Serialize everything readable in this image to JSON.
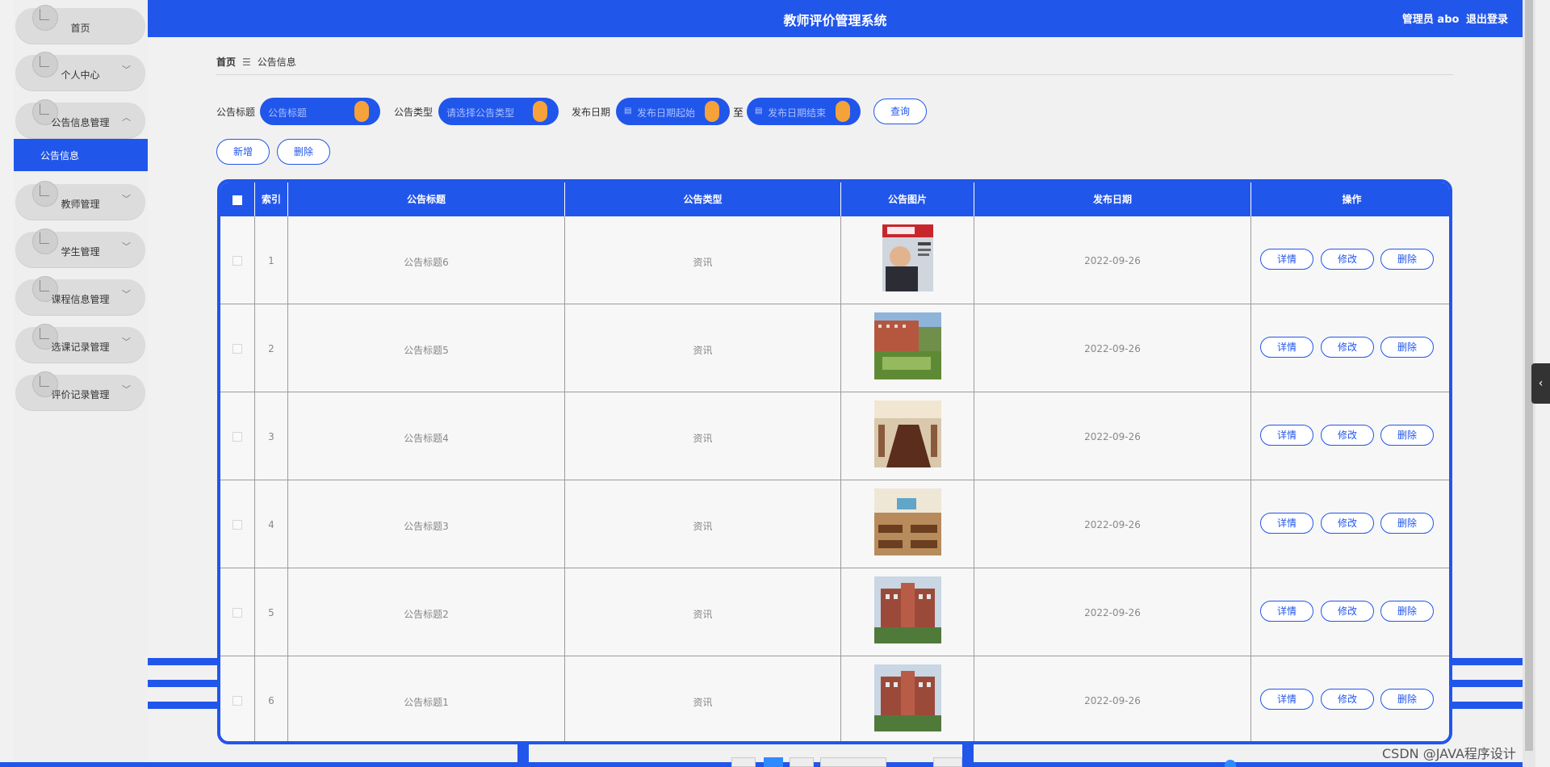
{
  "app": {
    "title": "教师评价管理系统"
  },
  "header": {
    "user_label": "管理员 abo",
    "logout_label": "退出登录"
  },
  "sidebar": {
    "items": [
      {
        "label": "首页",
        "chevron": ""
      },
      {
        "label": "个人中心",
        "chevron": "﹀"
      },
      {
        "label": "公告信息管理",
        "chevron": "︿"
      },
      {
        "label": "教师管理",
        "chevron": "﹀"
      },
      {
        "label": "学生管理",
        "chevron": "﹀"
      },
      {
        "label": "课程信息管理",
        "chevron": "﹀"
      },
      {
        "label": "选课记录管理",
        "chevron": "﹀"
      },
      {
        "label": "评价记录管理",
        "chevron": "﹀"
      }
    ],
    "active_sub": "公告信息"
  },
  "breadcrumb": {
    "home": "首页",
    "separator": "☰",
    "current": "公告信息"
  },
  "search": {
    "title_label": "公告标题",
    "title_placeholder": "公告标题",
    "type_label": "公告类型",
    "type_placeholder": "请选择公告类型",
    "date_label": "发布日期",
    "date_start_placeholder": "发布日期起始",
    "date_to": "至",
    "date_end_placeholder": "发布日期结束",
    "query_label": "查询"
  },
  "actions": {
    "add_label": "新增",
    "delete_label": "删除"
  },
  "table": {
    "columns": [
      "索引",
      "公告标题",
      "公告类型",
      "公告图片",
      "发布日期",
      "操作"
    ],
    "row_actions": [
      "详情",
      "修改",
      "删除"
    ],
    "rows": [
      {
        "index": "1",
        "title": "公告标题6",
        "type": "资讯",
        "image": "magazine-cover",
        "date": "2022-09-26"
      },
      {
        "index": "2",
        "title": "公告标题5",
        "type": "资讯",
        "image": "campus-building",
        "date": "2022-09-26"
      },
      {
        "index": "3",
        "title": "公告标题4",
        "type": "资讯",
        "image": "conference-room",
        "date": "2022-09-26"
      },
      {
        "index": "4",
        "title": "公告标题3",
        "type": "资讯",
        "image": "library-hall",
        "date": "2022-09-26"
      },
      {
        "index": "5",
        "title": "公告标题2",
        "type": "资讯",
        "image": "school-facade",
        "date": "2022-09-26"
      },
      {
        "index": "6",
        "title": "公告标题1",
        "type": "资讯",
        "image": "school-facade",
        "date": "2022-09-26"
      }
    ]
  },
  "watermark": "CSDN @JAVA程序设计",
  "colors": {
    "primary": "#2156eb",
    "knob": "#f5a23a",
    "sidebar_bg": "#f0efef"
  }
}
